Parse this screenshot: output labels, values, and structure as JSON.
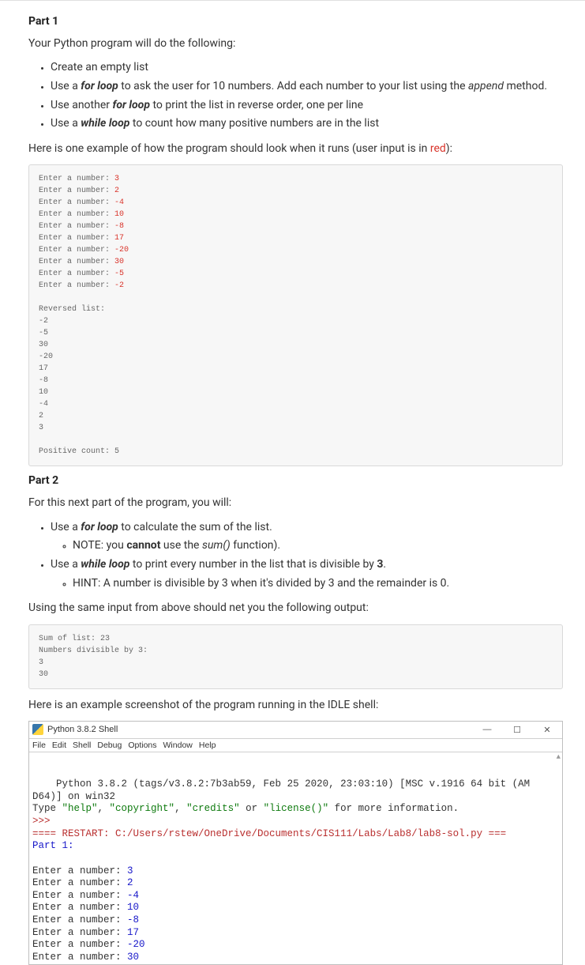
{
  "part1": {
    "title": "Part 1",
    "intro": "Your Python program will do the following:",
    "bullets": {
      "b1": "Create an empty list",
      "b2a": "Use a ",
      "b2b": "for loop",
      "b2c": " to ask the user for 10 numbers. Add each number to your list using the ",
      "b2d": "append",
      "b2e": " method.",
      "b3a": "Use another ",
      "b3b": "for loop",
      "b3c": " to print the list in reverse order, one per line",
      "b4a": "Use a ",
      "b4b": "while loop",
      "b4c": " to count how many positive numbers are in the list"
    },
    "example_intro_a": "Here is one example of how the program should look when it runs (user input is in ",
    "example_intro_red": "red",
    "example_intro_b": "):",
    "code": {
      "prompts": [
        "Enter a number: ",
        "Enter a number: ",
        "Enter a number: ",
        "Enter a number: ",
        "Enter a number: ",
        "Enter a number: ",
        "Enter a number: ",
        "Enter a number: ",
        "Enter a number: ",
        "Enter a number: "
      ],
      "inputs": [
        "3",
        "2",
        "-4",
        "10",
        "-8",
        "17",
        "-20",
        "30",
        "-5",
        "-2"
      ],
      "rev_label": "Reversed list:",
      "rev": [
        "-2",
        "-5",
        "30",
        "-20",
        "17",
        "-8",
        "10",
        "-4",
        "2",
        "3"
      ],
      "pos_count": "Positive count: 5"
    }
  },
  "part2": {
    "title": "Part 2",
    "intro": "For this next part of the program, you will:",
    "bullets": {
      "b1a": "Use a ",
      "b1b": "for loop",
      "b1c": " to calculate the sum of the list.",
      "b1note_a": "NOTE: you ",
      "b1note_b": "cannot",
      "b1note_c": " use the ",
      "b1note_d": "sum()",
      "b1note_e": " function).",
      "b2a": "Use a ",
      "b2b": "while loop",
      "b2c": " to print every number in the list that is divisible by ",
      "b2d": "3",
      "b2e": ".",
      "b2hint": "HINT: A number is divisible by 3 when it's divided by 3  and the remainder is 0."
    },
    "using_same": "Using the same input from above should net you the following output:",
    "code": {
      "sum": "Sum of list: 23",
      "div_label": "Numbers divisible by 3:",
      "divs": [
        "3",
        "30"
      ]
    },
    "screenshot_intro": "Here is an example screenshot of the program running in the IDLE shell:"
  },
  "idle": {
    "title": "Python 3.8.2 Shell",
    "menu": [
      "File",
      "Edit",
      "Shell",
      "Debug",
      "Options",
      "Window",
      "Help"
    ],
    "controls": {
      "min": "—",
      "max": "☐",
      "close": "✕"
    },
    "line1a": "Python 3.8.2 (tags/v3.8.2:7b3ab59, Feb 25 2020, 23:03:10) [MSC v.1916 64 bit (AM",
    "line1b": "D64)] on win32",
    "line2a": "Type ",
    "line2_q1": "\"help\"",
    "line2b": ", ",
    "line2_q2": "\"copyright\"",
    "line2c": ", ",
    "line2_q3": "\"credits\"",
    "line2d": " or ",
    "line2_q4": "\"license()\"",
    "line2e": " for more information.",
    "prompt": ">>>",
    "restart": "==== RESTART: C:/Users/rstew/OneDrive/Documents/CIS111/Labs/Lab8/lab8-sol.py ===",
    "part1_line": "Part 1:",
    "enter_lines": [
      {
        "p": "Enter a number: ",
        "v": "3"
      },
      {
        "p": "Enter a number: ",
        "v": "2"
      },
      {
        "p": "Enter a number: ",
        "v": "-4"
      },
      {
        "p": "Enter a number: ",
        "v": "10"
      },
      {
        "p": "Enter a number: ",
        "v": "-8"
      },
      {
        "p": "Enter a number: ",
        "v": "17"
      },
      {
        "p": "Enter a number: ",
        "v": "-20"
      },
      {
        "p": "Enter a number: ",
        "v": "30"
      }
    ]
  }
}
